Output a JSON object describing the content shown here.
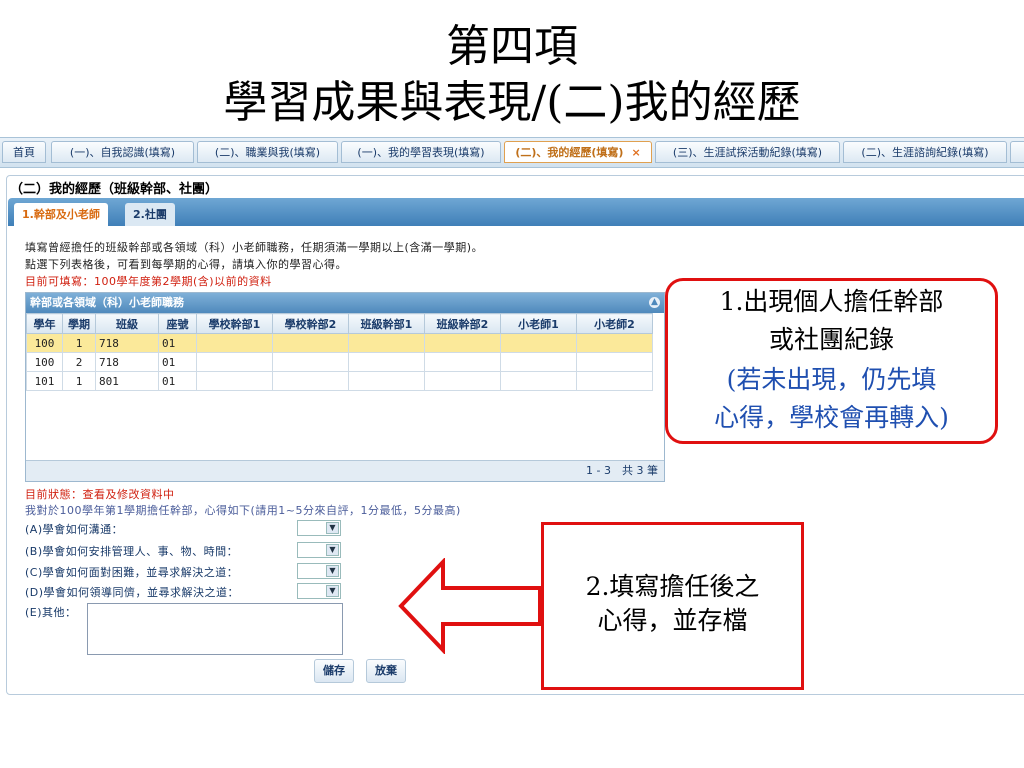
{
  "slide": {
    "title_line1": "第四項",
    "title_line2": "學習成果與表現/(二)我的經歷"
  },
  "tabs": [
    {
      "label": "首頁"
    },
    {
      "label": "(一)、自我認識(填寫)"
    },
    {
      "label": "(二)、職業與我(填寫)"
    },
    {
      "label": "(一)、我的學習表現(填寫)"
    },
    {
      "label": "(二)、我的經歷(填寫)",
      "active": true,
      "close": "×"
    },
    {
      "label": "(三)、生涯試探活動紀錄(填寫)"
    },
    {
      "label": "(二)、生涯諮詢紀錄(填寫)"
    }
  ],
  "section_title": "（二）我的經歷（班級幹部、社團）",
  "subtabs": {
    "active": "1.幹部及小老師",
    "inactive": "2.社團"
  },
  "instructions": {
    "line1": "填寫曾經擔任的班級幹部或各領域（科）小老師職務，任期須滿一學期以上(含滿一學期)。",
    "line2": "點選下列表格後，可看到每學期的心得，請填入你的學習心得。",
    "line3": "目前可填寫：100學年度第2學期(含)以前的資料"
  },
  "grid": {
    "caption": "幹部或各領域（科）小老師職務",
    "columns": [
      "學年",
      "學期",
      "班級",
      "座號",
      "學校幹部1",
      "學校幹部2",
      "班級幹部1",
      "班級幹部2",
      "小老師1",
      "小老師2"
    ],
    "rows": [
      [
        "100",
        "1",
        "718",
        "01",
        "",
        "",
        "",
        "",
        "",
        ""
      ],
      [
        "100",
        "2",
        "718",
        "01",
        "",
        "",
        "",
        "",
        "",
        ""
      ],
      [
        "101",
        "1",
        "801",
        "01",
        "",
        "",
        "",
        "",
        "",
        ""
      ]
    ],
    "footer": "1 - 3　共 3 筆"
  },
  "form": {
    "status": "目前狀態：查看及修改資料中",
    "intro": "我對於100學年第1學期擔任幹部，心得如下(請用1~5分來自評，1分最低，5分最高)",
    "questions": [
      "(A)學會如何溝通：",
      "(B)學會如何安排管理人、事、物、時間：",
      "(C)學會如何面對困難，並尋求解決之道：",
      "(D)學會如何領導同儕，並尋求解決之道："
    ],
    "other_label": "(E)其他：",
    "save_label": "儲存",
    "cancel_label": "放棄"
  },
  "callout1": {
    "line1": "1.出現個人擔任幹部",
    "line2": "或社團紀錄",
    "line3": "(若未出現，仍先填",
    "line4": "心得，學校會再轉入)"
  },
  "callout2": {
    "line1": "2.填寫擔任後之",
    "line2": "心得，並存檔"
  },
  "colors": {
    "callout_border": "#e01010",
    "accent_blue": "#1f4fb0",
    "header_blue": "#4f89bc"
  }
}
